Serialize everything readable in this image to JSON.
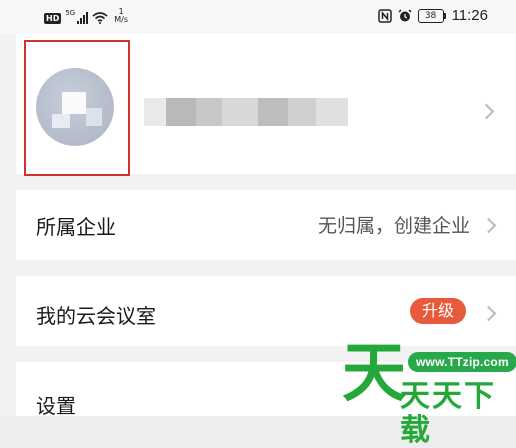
{
  "status_bar": {
    "hd_badge": "HD",
    "signal_label": "5G",
    "speed_value": "1",
    "speed_unit": "M/s",
    "battery": "38",
    "time": "11:26"
  },
  "profile": {
    "name_redacted": true
  },
  "rows": {
    "company_label": "所属企业",
    "company_value": "无归属，创建企业",
    "room_label": "我的云会议室",
    "room_badge": "升级",
    "settings_label": "设置"
  },
  "watermark": {
    "big_char": "天",
    "url": "www.TTzip.com",
    "text": "天天下载",
    "color": "#24a83a"
  },
  "colors": {
    "highlight_border": "#d32f2f",
    "badge": "#e85a3c"
  }
}
